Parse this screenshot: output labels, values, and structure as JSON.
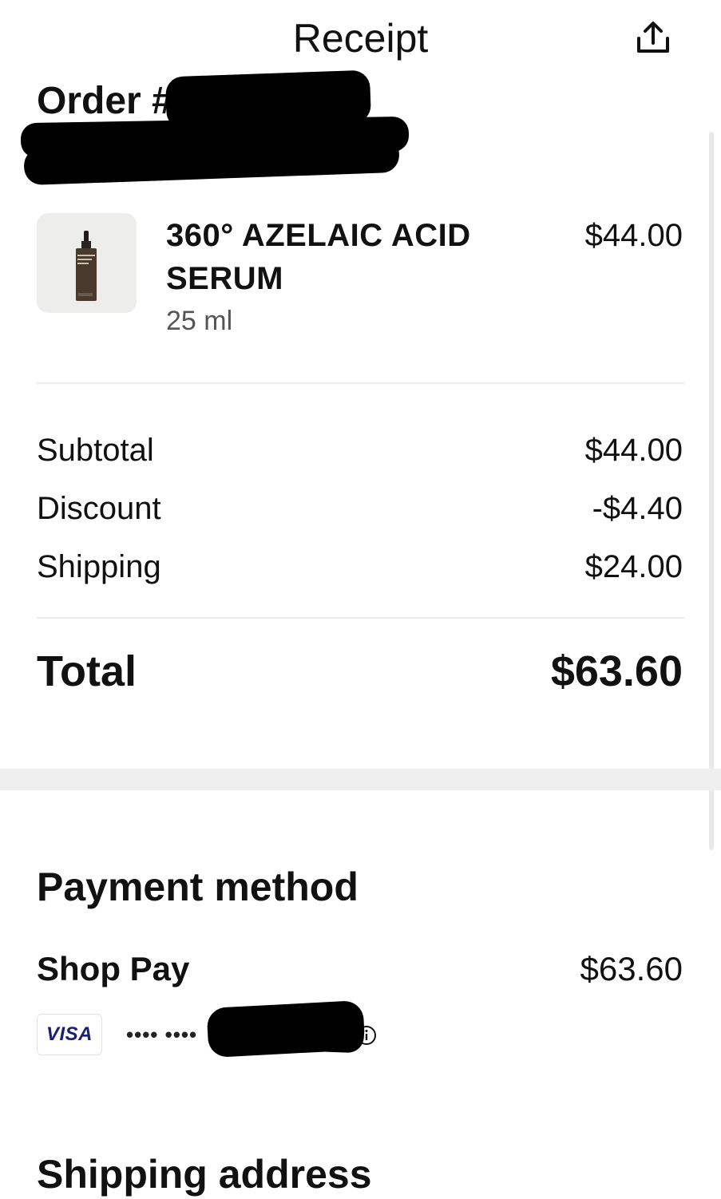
{
  "header": {
    "title": "Receipt",
    "share_icon": "share-icon"
  },
  "order": {
    "number_label": "Order #"
  },
  "line_item": {
    "name": "360° AZELAIC ACID SERUM",
    "variant": "25 ml",
    "price": "$44.00",
    "thumbnail_icon": "product-bottle-image"
  },
  "summary": {
    "rows": [
      {
        "label": "Subtotal",
        "value": "$44.00"
      },
      {
        "label": "Discount",
        "value": "-$4.40"
      },
      {
        "label": "Shipping",
        "value": "$24.00"
      }
    ],
    "total_label": "Total",
    "total_value": "$63.60"
  },
  "payment": {
    "heading": "Payment method",
    "method_name": "Shop Pay",
    "amount": "$63.60",
    "card_brand": "VISA",
    "card_mask": "•••• ••••",
    "info_icon": "info-icon"
  },
  "shipping": {
    "heading": "Shipping address"
  },
  "colors": {
    "text": "#111111",
    "muted": "#555555",
    "divider": "#ececec",
    "visa_blue": "#1a1f71"
  }
}
